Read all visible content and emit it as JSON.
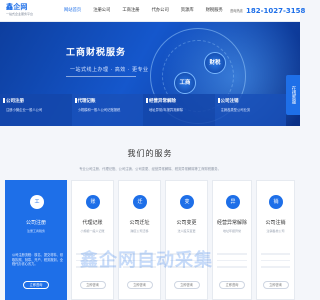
{
  "header": {
    "logo": "鑫企网",
    "logo_sub": "一站式企业服务平台",
    "nav": [
      "网站首页",
      "注册公司",
      "工商注册",
      "代办公司",
      "资源库",
      "财税服务"
    ],
    "phone_label": "咨询热线",
    "phone": "182-1027-3158"
  },
  "hero": {
    "title": "工商财税服务",
    "subtitle": "一站式线上办理 · 高效 · 更专业",
    "badge_left": "工商",
    "badge_right": "财税"
  },
  "side_tab": "在线客服",
  "features": [
    {
      "title": "公司注册",
      "desc": "注册小微企业一般人公司"
    },
    {
      "title": "代理记账",
      "desc": "小规模和一般人公司记账报税"
    },
    {
      "title": "经营异常解除",
      "desc": "地址异常/年报异常解除"
    },
    {
      "title": "公司注销",
      "desc": "注销各类型公司业务"
    }
  ],
  "services": {
    "title": "我们的服务",
    "desc": "专业公司注册、代理记账、公司注销、公司变更、经营异常解除、税务异常解除等工商财税服务。",
    "cards": [
      {
        "icon": "工",
        "name": "公司注册",
        "sub": "注册工商税务",
        "body": "公司注册流程：核名、提交材料、领取执照、刻章、开户、税务报到，全程代办省心省力。",
        "button": "立即咨询"
      },
      {
        "icon": "账",
        "name": "代理记账",
        "sub": "小规模一般人记账",
        "button": "立即咨询"
      },
      {
        "icon": "迁",
        "name": "公司迁址",
        "sub": "跨区公司迁移",
        "button": "立即咨询"
      },
      {
        "icon": "变",
        "name": "公司变更",
        "sub": "法人股东变更",
        "button": "立即咨询"
      },
      {
        "icon": "异",
        "name": "经营异常解除",
        "sub": "地址年报异常",
        "button": "立即咨询"
      },
      {
        "icon": "销",
        "name": "公司注销",
        "sub": "注销各类公司",
        "button": "立即咨询"
      }
    ]
  },
  "watermark": "鑫企网自动采集"
}
